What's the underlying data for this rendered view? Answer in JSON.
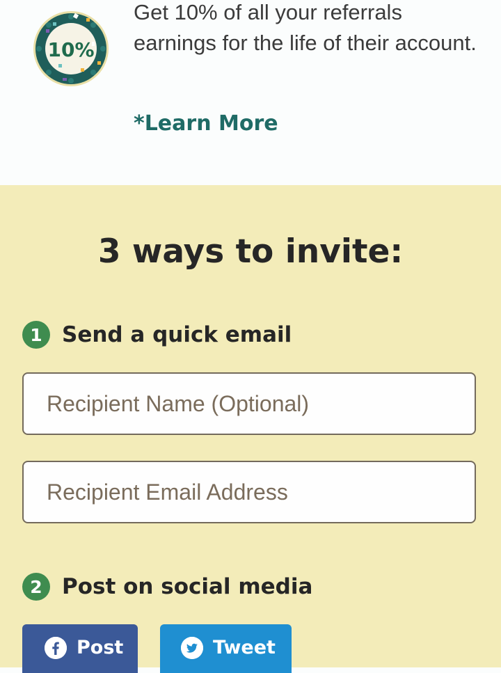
{
  "promo": {
    "badge_text": "10%",
    "text": "Get 10% of all your referrals earnings for the life of their account.",
    "learn_more": "*Learn More"
  },
  "invite": {
    "title": "3 ways to invite:",
    "steps": [
      {
        "number": "1",
        "label": "Send a quick email"
      },
      {
        "number": "2",
        "label": "Post on social media"
      }
    ],
    "email_form": {
      "name_placeholder": "Recipient Name (Optional)",
      "email_placeholder": "Recipient Email Address"
    },
    "social": {
      "facebook_label": "Post",
      "twitter_label": "Tweet"
    }
  },
  "colors": {
    "accent_teal": "#1f6b66",
    "step_green": "#3f8c4f",
    "invite_bg": "#f3ecb9",
    "facebook": "#3b5998",
    "twitter": "#1f8fd1"
  },
  "icons": [
    "ten-percent-badge-icon",
    "facebook-icon",
    "twitter-icon"
  ]
}
